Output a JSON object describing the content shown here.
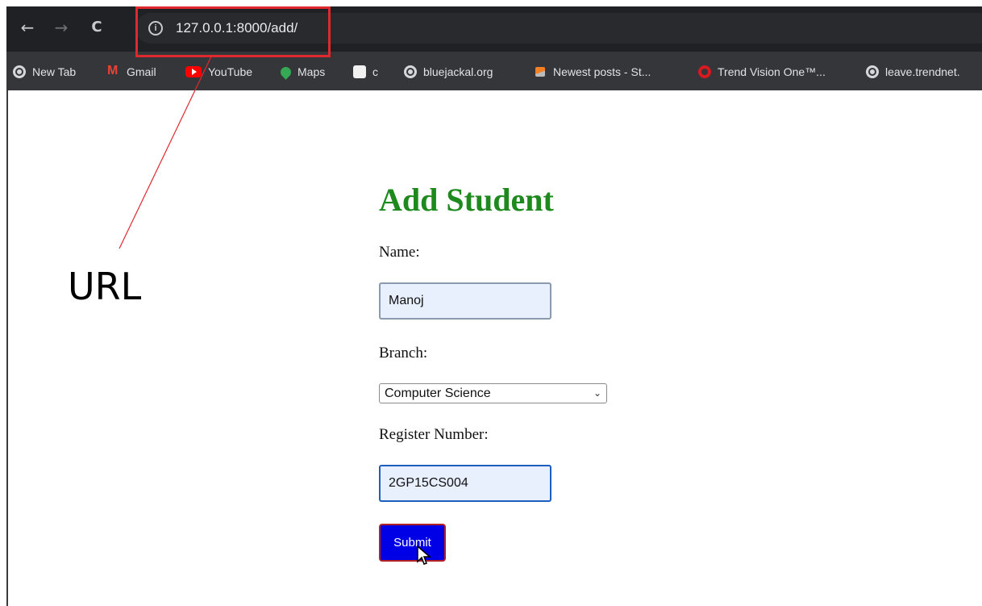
{
  "browser": {
    "url": "127.0.0.1:8000/add/",
    "nav": {
      "back": "←",
      "forward": "→",
      "reload": "C"
    },
    "info_glyph": "i",
    "bookmarks": [
      {
        "label": "New Tab",
        "icon": "globe-icon"
      },
      {
        "label": "Gmail",
        "icon": "gmail-icon"
      },
      {
        "label": "YouTube",
        "icon": "youtube-icon"
      },
      {
        "label": "Maps",
        "icon": "maps-icon"
      },
      {
        "label": "c",
        "icon": "hexagon-icon"
      },
      {
        "label": "bluejackal.org",
        "icon": "globe-icon"
      },
      {
        "label": "Newest posts - St...",
        "icon": "stackoverflow-icon"
      },
      {
        "label": "Trend Vision One™...",
        "icon": "trend-icon"
      },
      {
        "label": "leave.trendnet.",
        "icon": "globe-icon"
      }
    ]
  },
  "form": {
    "title": "Add Student",
    "name_label": "Name:",
    "name_value": "Manoj",
    "branch_label": "Branch:",
    "branch_value": "Computer Science",
    "register_label": "Register Number:",
    "register_value": "2GP15CS004",
    "submit_label": "Submit"
  },
  "annotation": {
    "text": "URL",
    "color": "#e0292f"
  },
  "colors": {
    "title_green": "#1e8a1e",
    "submit_blue": "#0000e6",
    "input_bg": "#e8f0fe",
    "chrome_dark": "#202124"
  }
}
